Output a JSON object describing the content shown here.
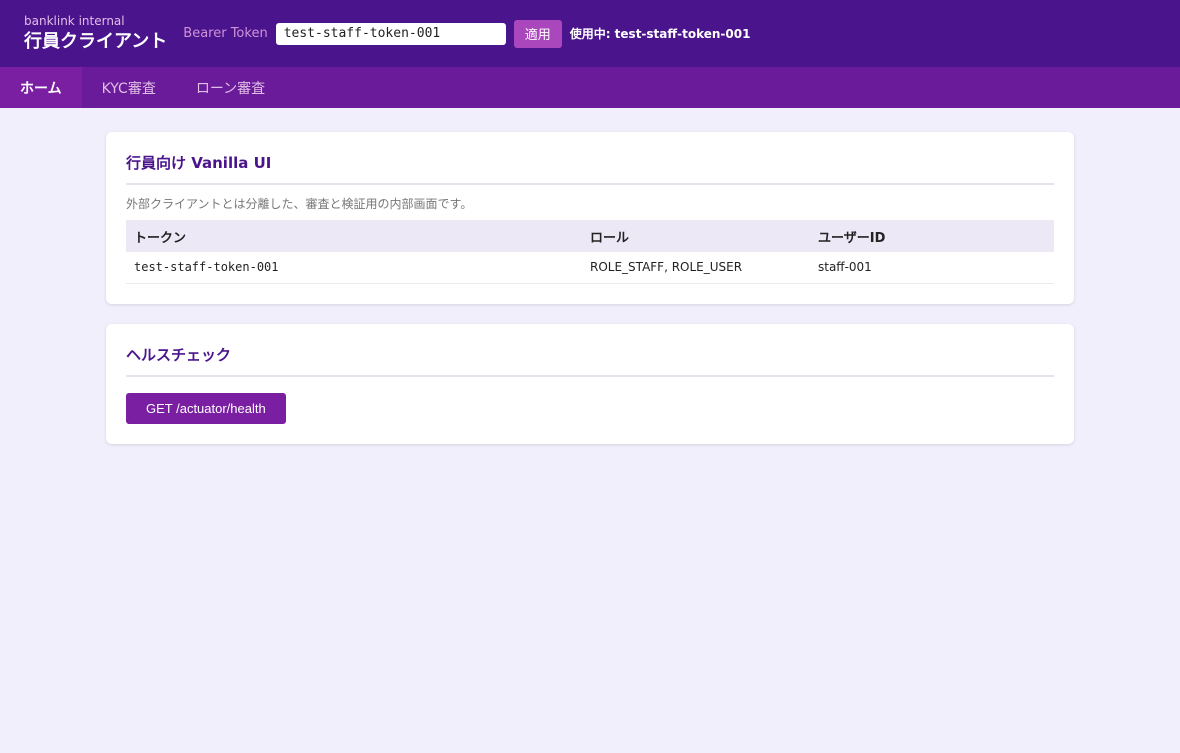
{
  "header": {
    "brand_sub": "banklink internal",
    "brand_title": "行員クライアント",
    "token_label": "Bearer Token",
    "token_value": "test-staff-token-001",
    "apply_label": "適用",
    "in_use_text": "使用中: test-staff-token-001"
  },
  "nav": {
    "tabs": [
      {
        "label": "ホーム",
        "active": true
      },
      {
        "label": "KYC審査",
        "active": false
      },
      {
        "label": "ローン審査",
        "active": false
      }
    ]
  },
  "intro_card": {
    "title": "行員向け Vanilla UI",
    "description": "外部クライアントとは分離した、審査と検証用の内部画面です。",
    "table": {
      "headers": [
        "トークン",
        "ロール",
        "ユーザーID"
      ],
      "rows": [
        [
          "test-staff-token-001",
          "ROLE_STAFF, ROLE_USER",
          "staff-001"
        ]
      ]
    }
  },
  "health_card": {
    "title": "ヘルスチェック",
    "button_label": "GET /actuator/health"
  }
}
